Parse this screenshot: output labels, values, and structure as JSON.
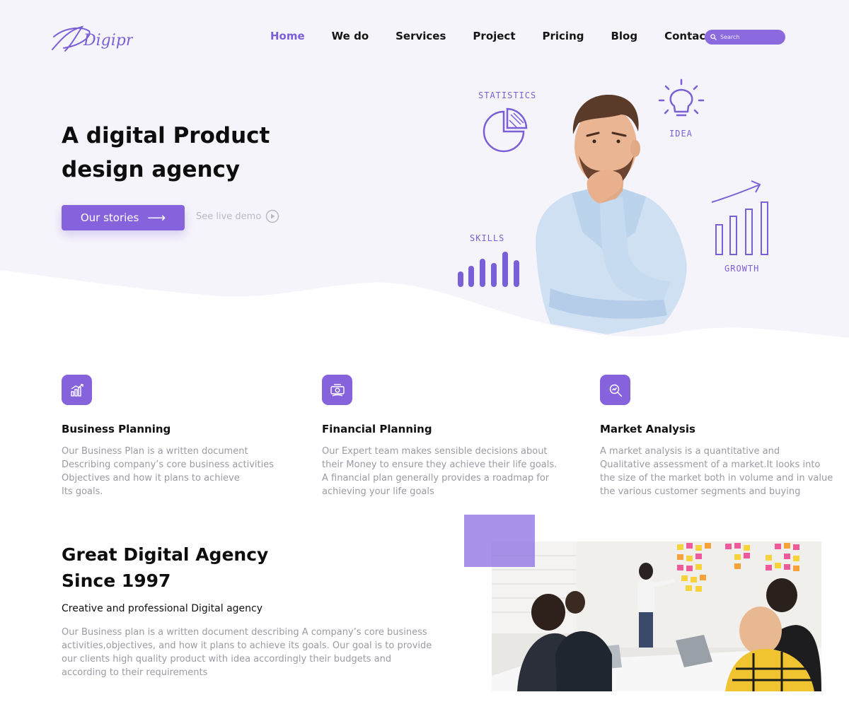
{
  "brand": {
    "logo_text": "Digipro",
    "accent": "#8662dd",
    "accent_text": "#7b5fd6"
  },
  "nav": {
    "items": [
      {
        "label": "Home",
        "active": true
      },
      {
        "label": "We do"
      },
      {
        "label": "Services"
      },
      {
        "label": "Project"
      },
      {
        "label": "Pricing"
      },
      {
        "label": "Blog"
      },
      {
        "label": "Contact"
      }
    ],
    "search": {
      "placeholder": "Search",
      "value": ""
    }
  },
  "hero": {
    "title_line1": "A digital Product",
    "title_line2": "design agency",
    "primary_button": "Our stories",
    "secondary_link": "See live demo",
    "doodles": {
      "statistics": "STATISTICS",
      "idea": "IDEA",
      "skills": "SKILLS",
      "growth": "GROWTH"
    }
  },
  "features": [
    {
      "title": "Business Planning",
      "icon": "growth-chart-icon",
      "lines": [
        "Our Business Plan is a written document",
        "Describing company’s core business activities",
        "Objectives and how it plans to achieve",
        "Its goals."
      ]
    },
    {
      "title": "Financial Planning",
      "icon": "money-icon",
      "lines": [
        "Our Expert team makes sensible decisions about",
        "their Money to ensure they achieve their life goals.",
        "A financial plan generally provides a roadmap for",
        "achieving your life goals"
      ]
    },
    {
      "title": "Market Analysis",
      "icon": "magnifier-chart-icon",
      "lines": [
        "A market analysis is a quantitative and",
        "Qualitative assessment of a market.It looks into",
        "the size of the market both in volume and in value",
        "the various customer segments and buying"
      ]
    }
  ],
  "about": {
    "title_line1": "Great Digital Agency",
    "title_line2": "Since 1997",
    "subtitle": "Creative and professional Digital agency",
    "lines": [
      "Our Business plan is a written document describing A company’s core business",
      "activities,objectives, and how it plans to achieve its goals. Our goal is to provide",
      "our clients high quality product with idea accordingly their budgets and",
      "according to their requirements"
    ]
  }
}
